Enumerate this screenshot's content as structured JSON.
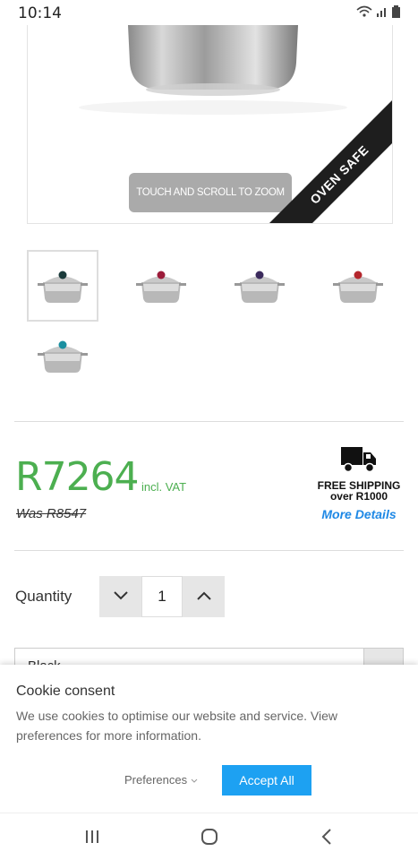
{
  "status_bar": {
    "time": "10:14",
    "icons": [
      "wifi-icon",
      "signal-icon",
      "battery-icon"
    ]
  },
  "product": {
    "zoom_hint": "TOUCH AND SCROLL TO ZOOM",
    "badge": "OVEN SAFE",
    "thumbnails": [
      {
        "knob_color": "#1a3a3a",
        "selected": true
      },
      {
        "knob_color": "#9c1b3a",
        "selected": false
      },
      {
        "knob_color": "#3b2a5c",
        "selected": false
      },
      {
        "knob_color": "#b4262c",
        "selected": false
      },
      {
        "knob_color": "#1a8fa0",
        "selected": false
      }
    ]
  },
  "pricing": {
    "price": "R7264",
    "vat_note": "incl. VAT",
    "was_price": "Was R8547",
    "accent_color": "#4caf50"
  },
  "shipping": {
    "icon": "truck-icon",
    "line1": "FREE SHIPPING",
    "line2": "over R1000",
    "link": "More Details"
  },
  "quantity": {
    "label": "Quantity",
    "value": "1"
  },
  "variant": {
    "selected": "Black"
  },
  "cookie": {
    "title": "Cookie consent",
    "text": "We use cookies to optimise our website and service. View preferences for more information.",
    "preferences_label": "Preferences",
    "accept_label": "Accept All",
    "accept_color": "#1da1f2"
  },
  "nav_bar": {
    "buttons": [
      "recent-apps-icon",
      "home-icon",
      "back-icon"
    ]
  }
}
